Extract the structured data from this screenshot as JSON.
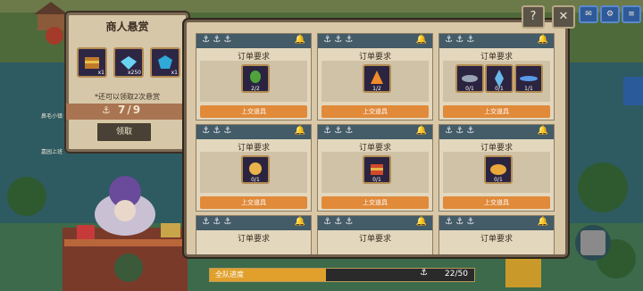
{
  "bounty": {
    "title": "商人悬赏",
    "rewards": [
      {
        "icon": "chest-icon",
        "count": "x1"
      },
      {
        "icon": "diamond-icon",
        "count": "x250"
      },
      {
        "icon": "gem-icon",
        "count": "x1"
      }
    ],
    "note": "*还可以领取2次悬赏",
    "progress": "7/9",
    "claim_label": "领取"
  },
  "orders": [
    {
      "title": "订单要求",
      "button": "上交道具",
      "items": [
        {
          "icon": "herb-icon",
          "count": "2/2"
        }
      ]
    },
    {
      "title": "订单要求",
      "button": "上交道具",
      "items": [
        {
          "icon": "fire-icon",
          "count": "1/2"
        }
      ]
    },
    {
      "title": "订单要求",
      "button": "上交道具",
      "items": [
        {
          "icon": "fish-icon",
          "count": "0/1"
        },
        {
          "icon": "crystal-icon",
          "count": "0/1"
        },
        {
          "icon": "swordfish-icon",
          "count": "1/1"
        }
      ]
    },
    {
      "title": "订单要求",
      "button": "上交道具",
      "items": [
        {
          "icon": "food-icon",
          "count": "0/1"
        }
      ]
    },
    {
      "title": "订单要求",
      "button": "上交道具",
      "items": [
        {
          "icon": "treasure-icon",
          "count": "0/1"
        }
      ]
    },
    {
      "title": "订单要求",
      "button": "上交道具",
      "items": [
        {
          "icon": "bread-icon",
          "count": "0/1"
        }
      ]
    },
    {
      "title": "订单要求"
    },
    {
      "title": "订单要求"
    },
    {
      "title": "订单要求"
    }
  ],
  "team": {
    "label": "全队进度",
    "count": "22/50",
    "fraction": 0.44
  },
  "side_labels": [
    "鼻毛小镇",
    "嘉园上班"
  ],
  "colors": {
    "accent": "#e08a3a",
    "header": "#445b68"
  }
}
